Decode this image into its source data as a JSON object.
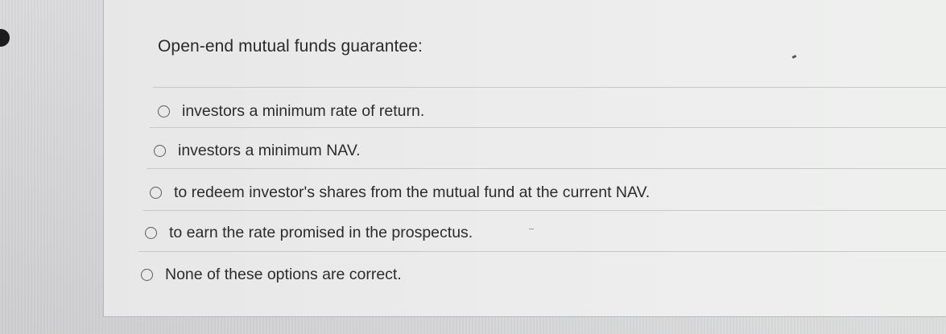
{
  "question": {
    "text": "Open-end mutual funds guarantee:"
  },
  "options": [
    {
      "label": "investors a minimum rate of return.",
      "selected": false
    },
    {
      "label": "investors a minimum NAV.",
      "selected": false
    },
    {
      "label": "to redeem investor's shares from the mutual fund at the current NAV.",
      "selected": false
    },
    {
      "label": "to earn the rate promised in the prospectus.",
      "selected": false
    },
    {
      "label": "None of these options are correct.",
      "selected": false
    }
  ]
}
